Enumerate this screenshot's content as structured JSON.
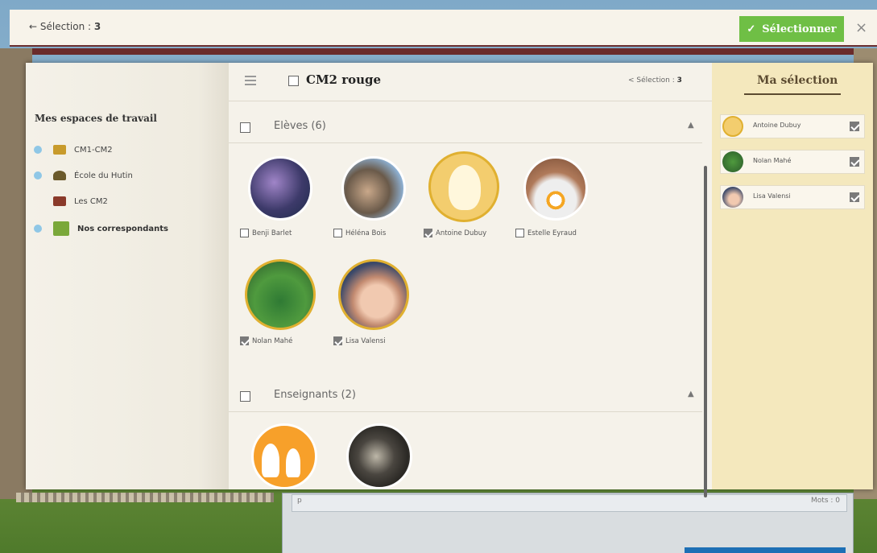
{
  "topbar": {
    "back_label": "Sélection :",
    "count": "3",
    "select_label": "Sélectionner",
    "close": "×"
  },
  "workspaces": {
    "heading": "Mes espaces de travail",
    "items": [
      {
        "label": "CM1-CM2",
        "has_dot": true,
        "bold": false,
        "icon_color": "#c89b2c"
      },
      {
        "label": "École du Hutin",
        "has_dot": true,
        "bold": false,
        "icon_color": "#6b5a2b"
      },
      {
        "label": "Les CM2",
        "has_dot": false,
        "bold": false,
        "icon_color": "#8a3a2a"
      },
      {
        "label": "Nos correspondants",
        "has_dot": true,
        "bold": true,
        "icon_color": "#7aa83a"
      }
    ]
  },
  "class": {
    "title": "CM2 rouge",
    "selection_label": "< Sélection :",
    "selection_count": "3"
  },
  "sections": {
    "students": {
      "label": "Elèves (6)"
    },
    "teachers": {
      "label": "Enseignants (2)"
    }
  },
  "students": [
    {
      "name": "Benji Barlet",
      "checked": false,
      "selected": false
    },
    {
      "name": "Héléna Bois",
      "checked": false,
      "selected": false
    },
    {
      "name": "Antoine Dubuy",
      "checked": true,
      "selected": true
    },
    {
      "name": "Estelle Eyraud",
      "checked": false,
      "selected": false
    },
    {
      "name": "Nolan Mahé",
      "checked": true,
      "selected": true
    },
    {
      "name": "Lisa Valensi",
      "checked": true,
      "selected": true
    }
  ],
  "selection_panel": {
    "heading": "Ma sélection",
    "items": [
      {
        "name": "Antoine Dubuy"
      },
      {
        "name": "Nolan Mahé"
      },
      {
        "name": "Lisa Valensi"
      }
    ]
  },
  "background": {
    "input_placeholder": "p",
    "words_label": "Mots : 0"
  }
}
